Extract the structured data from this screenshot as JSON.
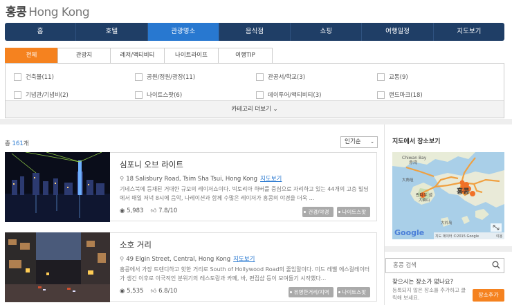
{
  "page": {
    "title_kr": "홍콩",
    "title_en": "Hong Kong"
  },
  "topnav": [
    {
      "label": "홈"
    },
    {
      "label": "호텔"
    },
    {
      "label": "관광명소",
      "active": true
    },
    {
      "label": "음식점"
    },
    {
      "label": "쇼핑"
    },
    {
      "label": "여행일정"
    },
    {
      "label": "지도보기"
    }
  ],
  "category_tabs": [
    {
      "label": "전체",
      "active": true
    },
    {
      "label": "관광지"
    },
    {
      "label": "레저/액티비티"
    },
    {
      "label": "나이트라이프"
    },
    {
      "label": "여행TIP"
    }
  ],
  "categories": [
    {
      "label": "건축물(11)"
    },
    {
      "label": "공원/정원/광장(11)"
    },
    {
      "label": "관공서/학교(3)"
    },
    {
      "label": "교통(9)"
    },
    {
      "label": "기념관/기념비(2)"
    },
    {
      "label": "나이트스팟(6)"
    },
    {
      "label": "데이투어/액티비티(3)"
    },
    {
      "label": "랜드마크(18)"
    }
  ],
  "more_categories": "카테고리 더보기",
  "results": {
    "prefix": "총 ",
    "count": "161",
    "suffix": "개",
    "sort": "인기순"
  },
  "listings": [
    {
      "title": "심포니 오브 라이트",
      "address": "18 Salisbury Road, Tsim Sha Tsui, Hong Kong",
      "map_link": "지도보기",
      "desc": "기네스북에 등재된 거대한 규모의 레이저쇼이다. 빅토리아 하버를 중심으로 자리하고 있는 44개의 고층 빌딩에서 매일 저녁 8시에 음악, 나레이션과 함께 수많은 레이저가 홍콩의 야경을 더욱 ...",
      "views": "5,983",
      "rating": "7.8/10",
      "tags": [
        "건경/야경",
        "나이트스팟"
      ]
    },
    {
      "title": "소호 거리",
      "address": "49 Elgin Street, Central, Hong Kong",
      "map_link": "지도보기",
      "desc": "홍콩에서 가장 트렌디하고 핫한 거리로 South of Hollywood Road의 줄임말이다. 미드 레벨 에스컬레이터가 생긴 이후로 이국적인 분위기의 레스토랑과 카페, 바, 편집샵 등이 모여들기 시작했다...",
      "views": "5,535",
      "rating": "6.8/10",
      "tags": [
        "유명한거리/지역",
        "나이트스팟"
      ]
    }
  ],
  "sidebar": {
    "map_title": "지도에서 장소보기",
    "map_labels": {
      "chiwan_bay": "Chiwan Bay",
      "chiwan_kr": "赤湾",
      "hongkong": "홍콩",
      "lantau": "란타우 섬",
      "lantau_cn": "大嶼山",
      "lamma": "大角咀",
      "pak_sha": "大衿岛",
      "google": "Google",
      "map_data": "지도 데이터 ©2015 Google",
      "terms": "이용"
    },
    "search_placeholder": "홍콩 검색",
    "no_place_title": "찾으시는 장소가 없나요?",
    "no_place_desc": "등록되지 않은 장소를 추가하고 클릭해 보세요.",
    "add_button": "장소추가"
  },
  "colors": {
    "nav": "#1f3e66",
    "nav_active": "#2878d0",
    "accent": "#f5821f",
    "link": "#2878d0"
  }
}
